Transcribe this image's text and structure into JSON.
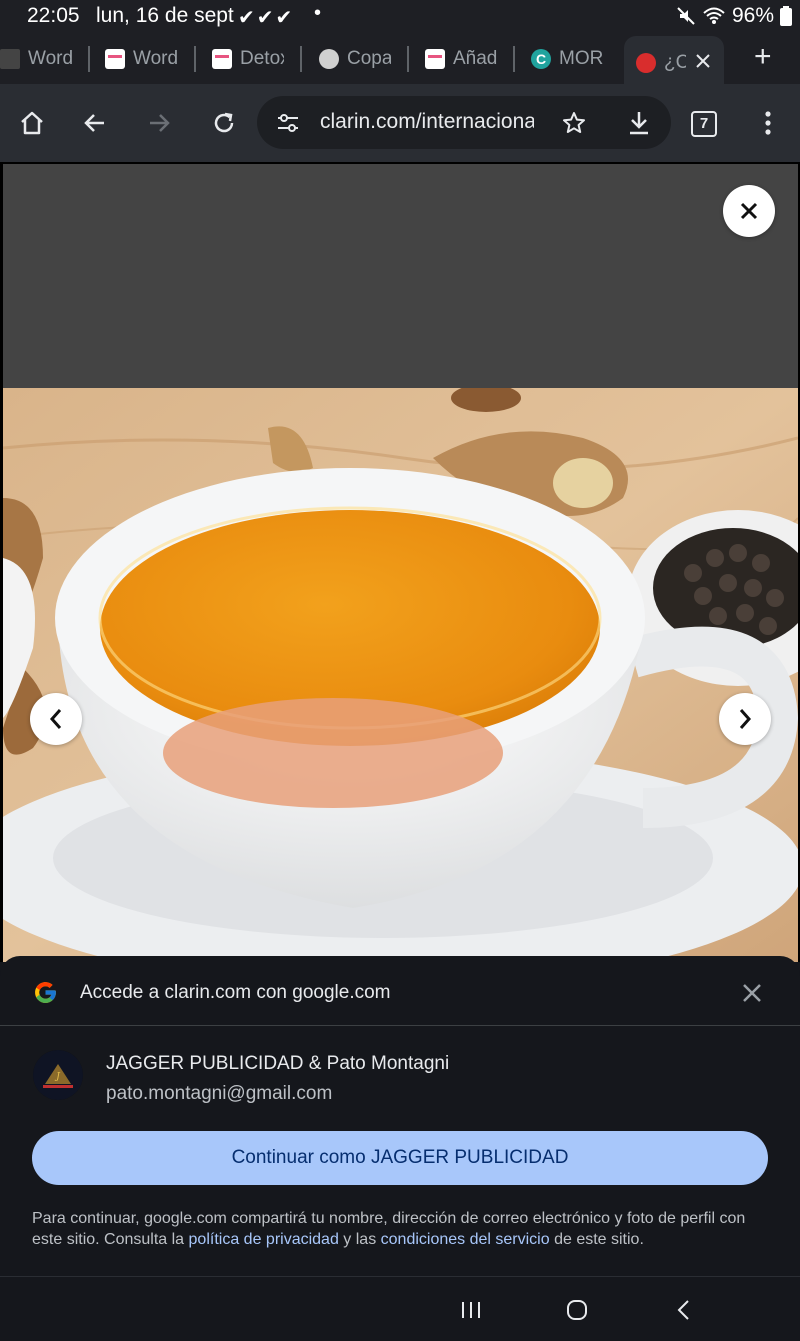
{
  "status_bar": {
    "time": "22:05",
    "date": "lun, 16 de sept",
    "checks": "✔✔✔",
    "battery": "96%",
    "icons": [
      "mute-icon",
      "wifi-icon",
      "battery-icon"
    ]
  },
  "tabs": [
    {
      "label": "Word",
      "favicon": "dark"
    },
    {
      "label": "Word",
      "favicon": "pink"
    },
    {
      "label": "Detox",
      "favicon": "pink"
    },
    {
      "label": "Copa",
      "favicon": "globe"
    },
    {
      "label": "Añad",
      "favicon": "pink"
    },
    {
      "label": "MOR",
      "favicon": "teal"
    },
    {
      "label": "¿C",
      "favicon": "red",
      "active": true
    }
  ],
  "toolbar": {
    "url": "clarin.com/internacional",
    "tab_count": "7"
  },
  "gallery": {
    "image_subject": "turmeric ginger tea cup with ginger root and black pepper"
  },
  "signin_sheet": {
    "title": "Accede a clarin.com con google.com",
    "account_name": "JAGGER PUBLICIDAD & Pato Montagni",
    "account_email": "pato.montagni@gmail.com",
    "continue_label": "Continuar como JAGGER PUBLICIDAD",
    "disclaimer_pre": "Para continuar, google.com compartirá tu nombre, dirección de correo electrónico y foto de perfil con este sitio. Consulta la ",
    "privacy_link": "política de privacidad",
    "disclaimer_mid": " y las ",
    "terms_link": "condiciones del servicio",
    "disclaimer_post": " de este sitio."
  },
  "colors": {
    "accent_button": "#a8c7fa",
    "sheet_bg": "#15171c",
    "toolbar_bg": "#2a2d33"
  }
}
